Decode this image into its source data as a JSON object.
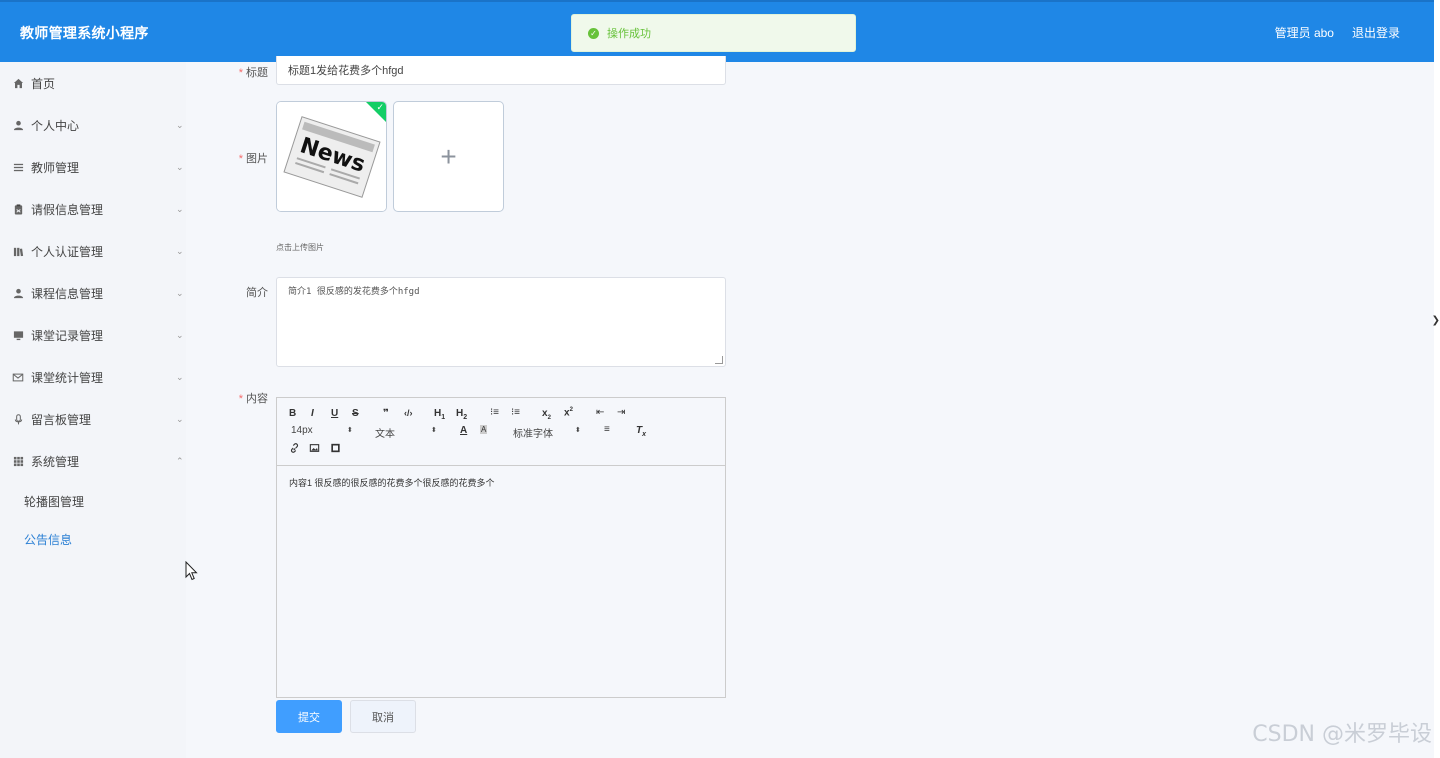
{
  "header": {
    "title": "教师管理系统小程序",
    "user_label": "管理员 abo",
    "logout_label": "退出登录"
  },
  "toast": {
    "message": "操作成功",
    "icon": "check-circle-icon",
    "color": "#67c23a"
  },
  "sidebar": {
    "items": [
      {
        "label": "首页",
        "icon": "home-icon"
      },
      {
        "label": "个人中心",
        "icon": "user-icon"
      },
      {
        "label": "教师管理",
        "icon": "list-icon"
      },
      {
        "label": "请假信息管理",
        "icon": "clipboard-icon"
      },
      {
        "label": "个人认证管理",
        "icon": "book-icon"
      },
      {
        "label": "课程信息管理",
        "icon": "person-icon"
      },
      {
        "label": "课堂记录管理",
        "icon": "monitor-icon"
      },
      {
        "label": "课堂统计管理",
        "icon": "mail-icon"
      },
      {
        "label": "留言板管理",
        "icon": "microphone-icon"
      },
      {
        "label": "系统管理",
        "icon": "grid-icon"
      }
    ],
    "sub_items": [
      {
        "label": "轮播图管理"
      },
      {
        "label": "公告信息"
      }
    ]
  },
  "form": {
    "title_label": "标题",
    "title_value": "标题1发给花费多个hfgd",
    "image_label": "图片",
    "image_alt": "News",
    "upload_hint": "点击上传图片",
    "intro_label": "简介",
    "intro_value": "简介1 很反感的发花费多个hfgd",
    "content_label": "内容",
    "content_value": "内容1 很反感的很反感的花费多个很反感的花费多个",
    "toolbar": {
      "font_size": "14px",
      "paragraph": "文本",
      "font_family": "标准字体"
    },
    "submit_label": "提交",
    "cancel_label": "取消"
  },
  "colors": {
    "primary": "#1f87e6",
    "accent": "#409eff",
    "success": "#13ce66",
    "danger": "#f56c6c"
  },
  "watermark": "CSDN @米罗毕设"
}
